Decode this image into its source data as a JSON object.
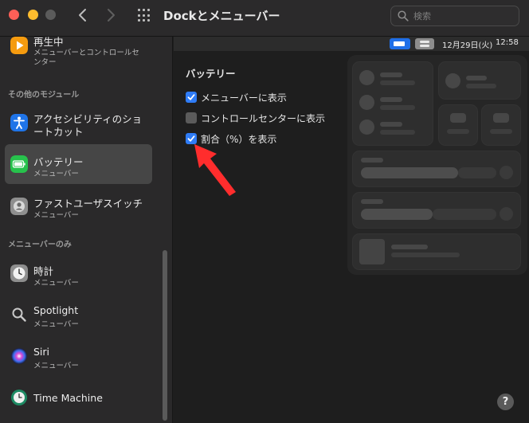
{
  "window": {
    "title": "Dockとメニューバー",
    "search_placeholder": "検索"
  },
  "sidebar": {
    "items": [
      {
        "title": "再生中",
        "subtitle": "メニューバーとコントロールセ",
        "subtitle2": "ンター",
        "icon": "play-icon"
      },
      {
        "title": "アクセシビリティのショ",
        "subtitle": "ートカット",
        "icon": "accessibility-icon"
      },
      {
        "title": "バッテリー",
        "subtitle": "メニューバー",
        "icon": "battery-icon",
        "selected": true
      },
      {
        "title": "ファストユーザスイッチ",
        "subtitle": "メニューバー",
        "icon": "user-switch-icon"
      },
      {
        "title": "時計",
        "subtitle": "メニューバー",
        "icon": "clock-icon"
      },
      {
        "title": "Spotlight",
        "subtitle": "メニューバー",
        "icon": "spotlight-icon"
      },
      {
        "title": "Siri",
        "subtitle": "メニューバー",
        "icon": "siri-icon"
      },
      {
        "title": "Time Machine",
        "subtitle": "",
        "icon": "time-machine-icon"
      }
    ],
    "sections": {
      "other_modules": "その他のモジュール",
      "menubar_only": "メニューバーのみ"
    }
  },
  "menubar_preview": {
    "date": "12月29日(火)",
    "time": "12:58"
  },
  "battery_panel": {
    "group_title": "バッテリー",
    "options": [
      {
        "label": "メニューバーに表示",
        "checked": true
      },
      {
        "label": "コントロールセンターに表示",
        "checked": false
      },
      {
        "label": "割合（%）を表示",
        "checked": true
      }
    ]
  },
  "help_label": "?",
  "colors": {
    "accent": "#2f7cf6",
    "arrow": "#ff2d2d",
    "battery_icon": "#27c24c"
  }
}
